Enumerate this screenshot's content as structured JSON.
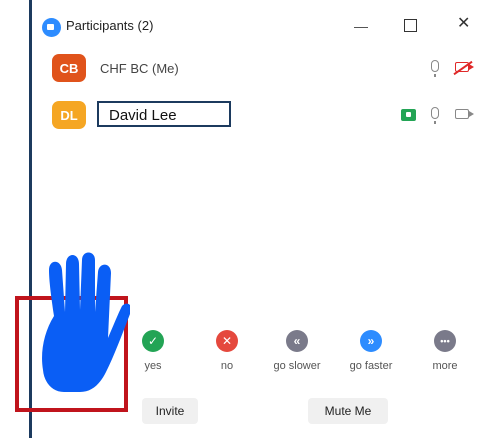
{
  "window": {
    "title": "Participants (2)",
    "controls": {
      "minimize": "",
      "maximize": "",
      "close": "✕"
    }
  },
  "participants": [
    {
      "initials": "CB",
      "name": "CHF BC (Me)",
      "avatar_color": "#e0531b",
      "mic": "mic-icon",
      "video": "video-off-icon"
    },
    {
      "initials": "DL",
      "name": "David Lee",
      "avatar_color": "#f5a623",
      "share": "screen-share-icon",
      "mic": "mic-icon",
      "video": "video-icon"
    }
  ],
  "reactions": [
    {
      "label": "yes",
      "color": "#23a455",
      "glyph": "✓"
    },
    {
      "label": "no",
      "color": "#e5483d",
      "glyph": "✕"
    },
    {
      "label": "go slower",
      "color": "#7a7a8a",
      "glyph": "«"
    },
    {
      "label": "go faster",
      "color": "#2d8cff",
      "glyph": "»"
    },
    {
      "label": "more",
      "color": "#7a7a8a",
      "glyph": "•••"
    }
  ],
  "footer": {
    "invite": "Invite",
    "mute": "Mute Me"
  },
  "overlay": {
    "highlight_color": "#c0141c",
    "hand_color": "#0a5ef5",
    "hand": "raise-hand-icon"
  }
}
